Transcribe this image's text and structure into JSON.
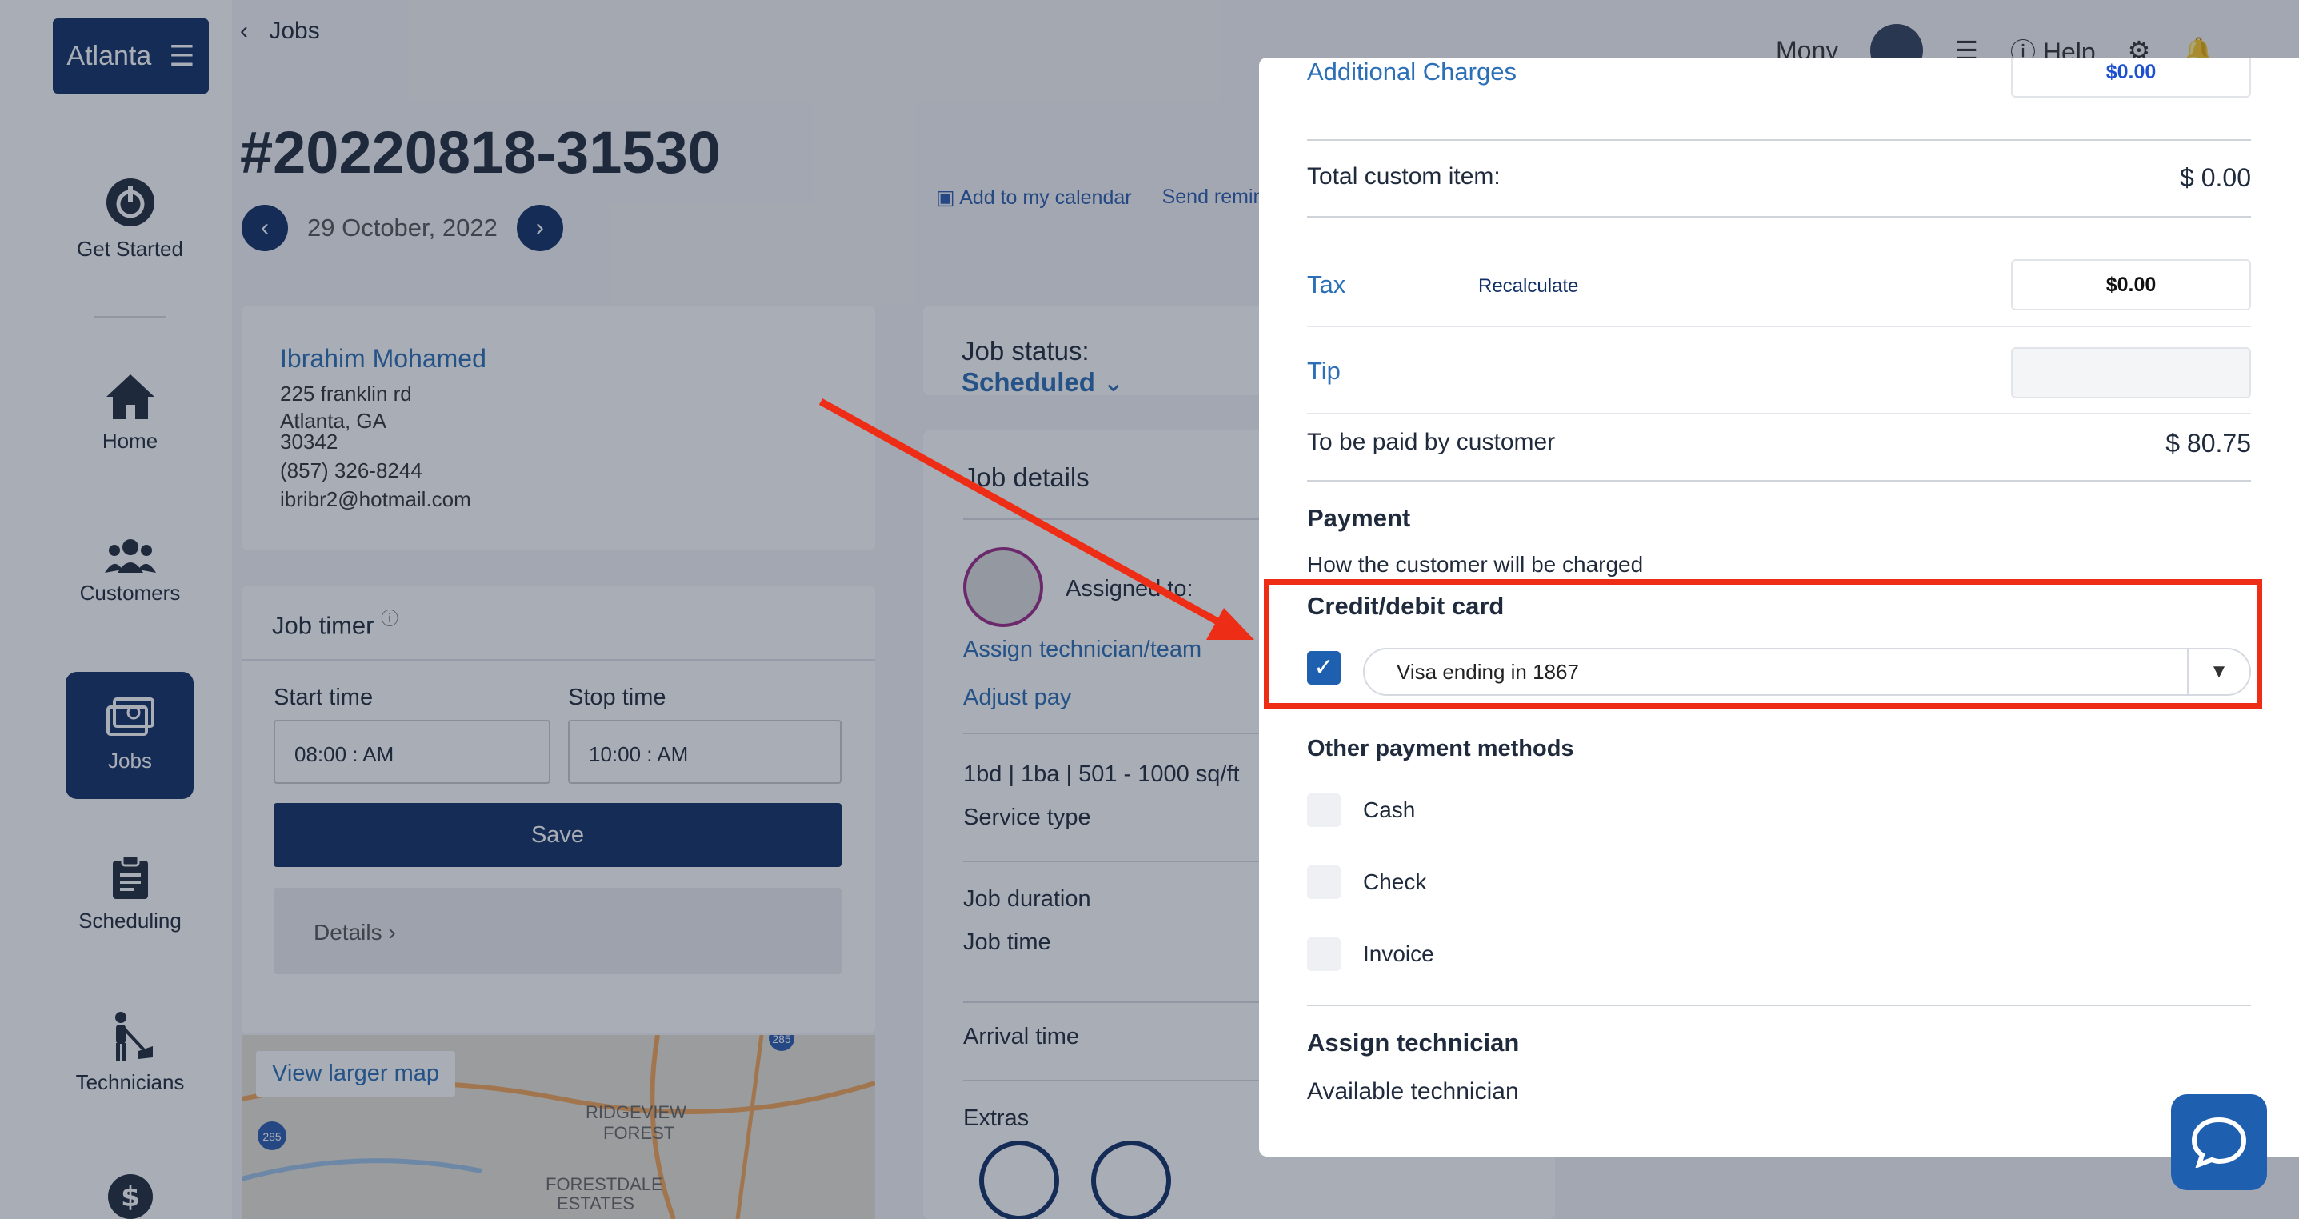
{
  "sidebar": {
    "brand": "Atlanta",
    "items": [
      {
        "label": "Get Started",
        "icon": "power-icon"
      },
      {
        "label": "Home",
        "icon": "home-icon"
      },
      {
        "label": "Customers",
        "icon": "customers-icon"
      },
      {
        "label": "Jobs",
        "icon": "jobs-icon"
      },
      {
        "label": "Scheduling",
        "icon": "clipboard-icon"
      },
      {
        "label": "Technicians",
        "icon": "technician-icon"
      },
      {
        "label": "",
        "icon": "dollar-icon"
      }
    ]
  },
  "header": {
    "back_label": "Jobs",
    "user_name": "Mony",
    "help_label": "Help"
  },
  "job": {
    "id": "#20220818-31530",
    "date": "29 October, 2022",
    "add_calendar": "Add to my calendar",
    "send_reminder": "Send reminde"
  },
  "customer": {
    "name": "Ibrahim Mohamed",
    "address1": "225 franklin rd",
    "address2": "Atlanta, GA",
    "zip": "30342",
    "phone": "(857) 326-8244",
    "email": "ibribr2@hotmail.com"
  },
  "timer": {
    "title": "Job timer",
    "start_label": "Start time",
    "start_value": "08:00 : AM",
    "stop_label": "Stop time",
    "stop_value": "10:00 : AM",
    "save_label": "Save",
    "details_label": "Details"
  },
  "map": {
    "view_larger": "View larger map",
    "labels": [
      "RIDGEVIEW",
      "FOREST",
      "FORESTDALE",
      "ESTATES"
    ],
    "shields": [
      "285",
      "285"
    ]
  },
  "status": {
    "label": "Job status:",
    "value": "Scheduled"
  },
  "job_details": {
    "title": "Job details",
    "assigned": "Assigned to:",
    "assign_link": "Assign technician/team",
    "adjust_pay": "Adjust pay",
    "size": "1bd | 1ba | 501 - 1000 sq/ft",
    "service_type": "Service type",
    "duration": "Job duration",
    "job_time": "Job time",
    "arrival": "Arrival time",
    "extras": "Extras"
  },
  "panel": {
    "additional_charges": "Additional Charges",
    "additional_value": "$0.00",
    "total_custom_label": "Total custom item:",
    "total_custom_value": "$ 0.00",
    "tax_label": "Tax",
    "recalculate": "Recalculate",
    "tax_value": "$0.00",
    "tip_label": "Tip",
    "tip_value": "",
    "to_be_paid_label": "To be paid by customer",
    "to_be_paid_value": "$ 80.75",
    "payment_title": "Payment",
    "payment_sub": "How the customer will be charged",
    "card_title": "Credit/debit card",
    "card_selected": "Visa ending in 1867",
    "other_title": "Other payment methods",
    "other_methods": [
      "Cash",
      "Check",
      "Invoice"
    ],
    "assign_title": "Assign technician",
    "available_label": "Available technician"
  },
  "colors": {
    "navy": "#0f2f66",
    "link_blue": "#2a6fb7",
    "highlight_red": "#ee2d16",
    "checkbox_blue": "#1f5fb0"
  }
}
